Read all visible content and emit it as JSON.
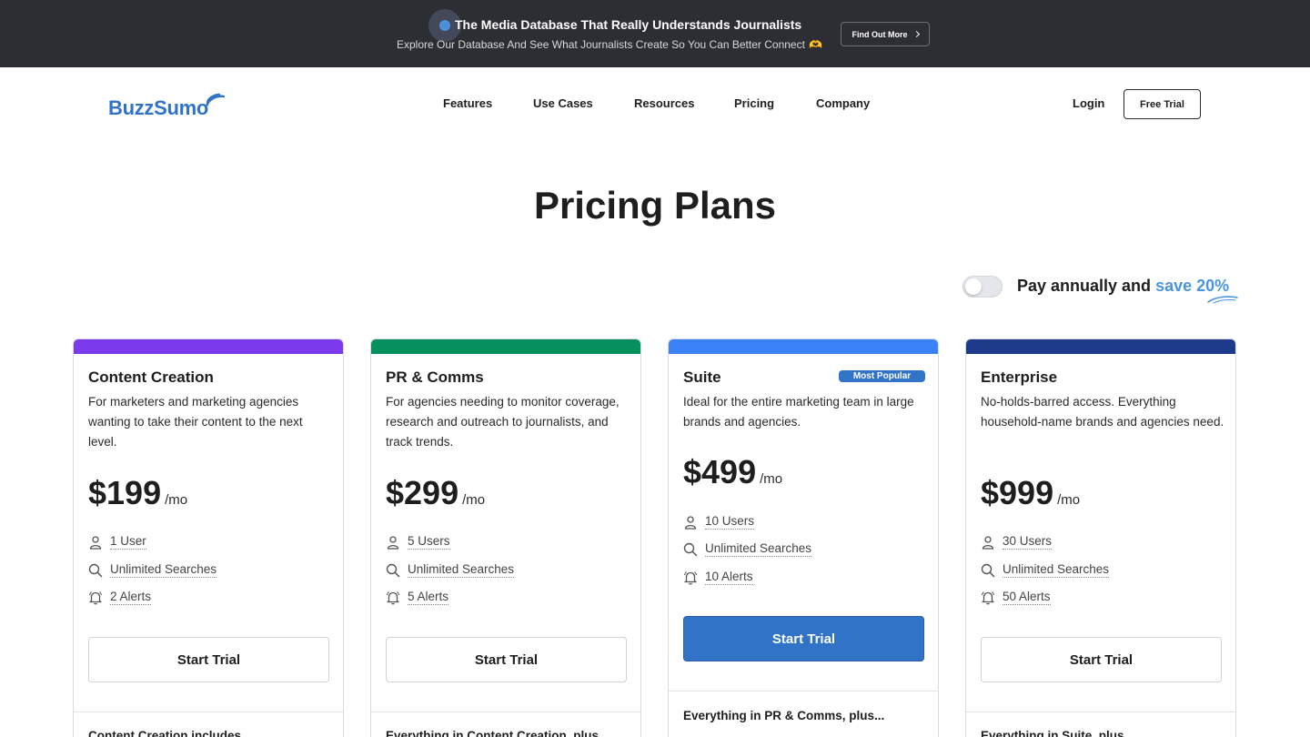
{
  "promo": {
    "title": "The Media Database That Really Understands Journalists",
    "subtitle": "Explore Our Database And See What Journalists Create So You Can Better Connect",
    "emoji": "🫶",
    "button_label": "Find Out More"
  },
  "header": {
    "logo_text": "BuzzSumo",
    "nav": [
      "Features",
      "Use Cases",
      "Resources",
      "Pricing",
      "Company"
    ],
    "login_label": "Login",
    "free_trial_label": "Free Trial"
  },
  "page": {
    "title": "Pricing Plans"
  },
  "billing_toggle": {
    "label_prefix": "Pay annually and ",
    "label_highlight": "save 20%",
    "enabled": false
  },
  "colors": {
    "brand": "#3173c6",
    "content_creation": "#7c3aed",
    "pr_comms": "#05905e",
    "suite": "#3b82f6",
    "enterprise": "#1e3a8a",
    "promo_bg": "#2d2e33"
  },
  "plans": [
    {
      "name": "Content Creation",
      "description": "For marketers and marketing agencies wanting to take their content to the next level.",
      "price": "$199",
      "period": "/mo",
      "features": [
        {
          "icon": "user-icon",
          "label": "1 User"
        },
        {
          "icon": "search-icon",
          "label": "Unlimited Searches"
        },
        {
          "icon": "bell-icon",
          "label": "2 Alerts"
        }
      ],
      "cta_label": "Start Trial",
      "includes_label": "Content Creation includes..."
    },
    {
      "name": "PR & Comms",
      "description": "For agencies needing to monitor coverage, research and outreach to journalists, and track trends.",
      "price": "$299",
      "period": "/mo",
      "features": [
        {
          "icon": "user-icon",
          "label": "5 Users"
        },
        {
          "icon": "search-icon",
          "label": "Unlimited Searches"
        },
        {
          "icon": "bell-icon",
          "label": "5 Alerts"
        }
      ],
      "cta_label": "Start Trial",
      "includes_label": "Everything in Content Creation, plus..."
    },
    {
      "name": "Suite",
      "badge": "Most Popular",
      "description": "Ideal for the entire marketing team in large brands and agencies.",
      "price": "$499",
      "period": "/mo",
      "features": [
        {
          "icon": "user-icon",
          "label": "10 Users"
        },
        {
          "icon": "search-icon",
          "label": "Unlimited Searches"
        },
        {
          "icon": "bell-icon",
          "label": "10 Alerts"
        }
      ],
      "cta_label": "Start Trial",
      "includes_label": "Everything in PR & Comms, plus..."
    },
    {
      "name": "Enterprise",
      "description": "No-holds-barred access. Everything household-name brands and agencies need.",
      "price": "$999",
      "period": "/mo",
      "features": [
        {
          "icon": "user-icon",
          "label": "30 Users"
        },
        {
          "icon": "search-icon",
          "label": "Unlimited Searches"
        },
        {
          "icon": "bell-icon",
          "label": "50 Alerts"
        }
      ],
      "cta_label": "Start Trial",
      "includes_label": "Everything in Suite, plus..."
    }
  ]
}
